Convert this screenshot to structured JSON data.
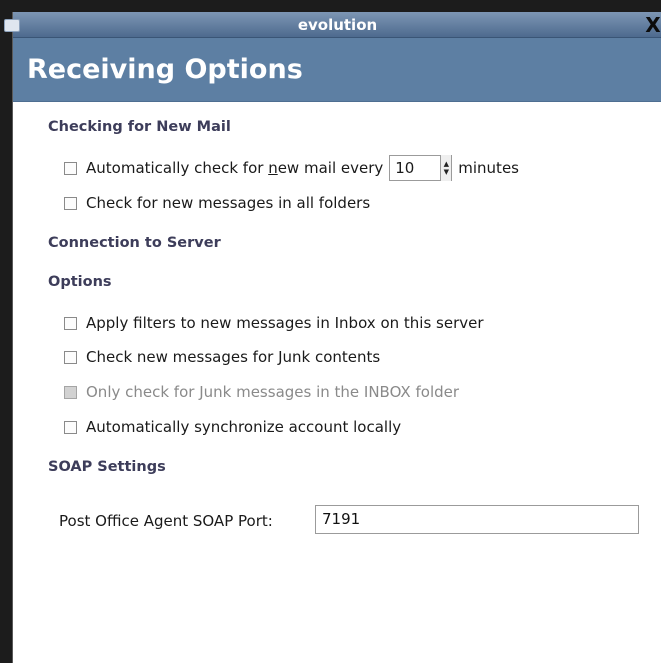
{
  "window": {
    "title": "evolution",
    "menu_icon": "window-menu-icon",
    "close_glyph": "X"
  },
  "page": {
    "heading": "Receiving Options"
  },
  "checking": {
    "heading": "Checking for New Mail",
    "auto_check": {
      "prefix": "Automatically check for ",
      "mnemonic": "n",
      "suffix": "ew mail every",
      "value": "10",
      "unit": "minutes",
      "checked": false
    },
    "all_folders": {
      "label": "Check for new messages in all folders",
      "checked": false
    }
  },
  "connection": {
    "heading": "Connection to Server"
  },
  "options": {
    "heading": "Options",
    "apply_filters": {
      "label": "Apply filters to new messages in Inbox on this server",
      "checked": false
    },
    "check_junk": {
      "label": "Check new messages for Junk contents",
      "checked": false
    },
    "junk_inbox_only": {
      "label": "Only check for Junk messages in the INBOX folder",
      "checked": false,
      "disabled": true
    },
    "sync_locally": {
      "label": "Automatically synchronize account locally",
      "checked": false
    }
  },
  "soap": {
    "heading": "SOAP Settings",
    "port_label": "Post Office Agent SOAP Port:",
    "port_value": "7191"
  },
  "colors": {
    "titlebar": "#5d7fa3",
    "banner": "#5d7fa3",
    "section_heading": "#3d3d5a"
  }
}
